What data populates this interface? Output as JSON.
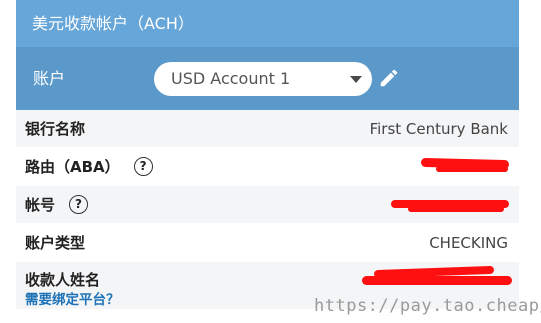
{
  "header": {
    "title": "美元收款帐户（ACH）"
  },
  "account": {
    "label": "账户",
    "selected": "USD Account 1"
  },
  "details": [
    {
      "label": "银行名称",
      "value": "First Century Bank"
    },
    {
      "label": "路由（ABA）",
      "value": ""
    },
    {
      "label": "帐号",
      "value": ""
    },
    {
      "label": "账户类型",
      "value": "CHECKING"
    },
    {
      "label": "收款人姓名",
      "value": ""
    }
  ],
  "link": {
    "text": "需要绑定平台？"
  },
  "help_icon_text": "?",
  "watermark": "https://pay.tao.cheap/",
  "colors": {
    "header_bg": "#66a6d8",
    "account_bar_bg": "#5a99c9",
    "link": "#1e73b8",
    "redaction": "#ff1010"
  },
  "icons": [
    "chevron-down-icon",
    "pencil-edit-icon",
    "question-circle-icon"
  ]
}
